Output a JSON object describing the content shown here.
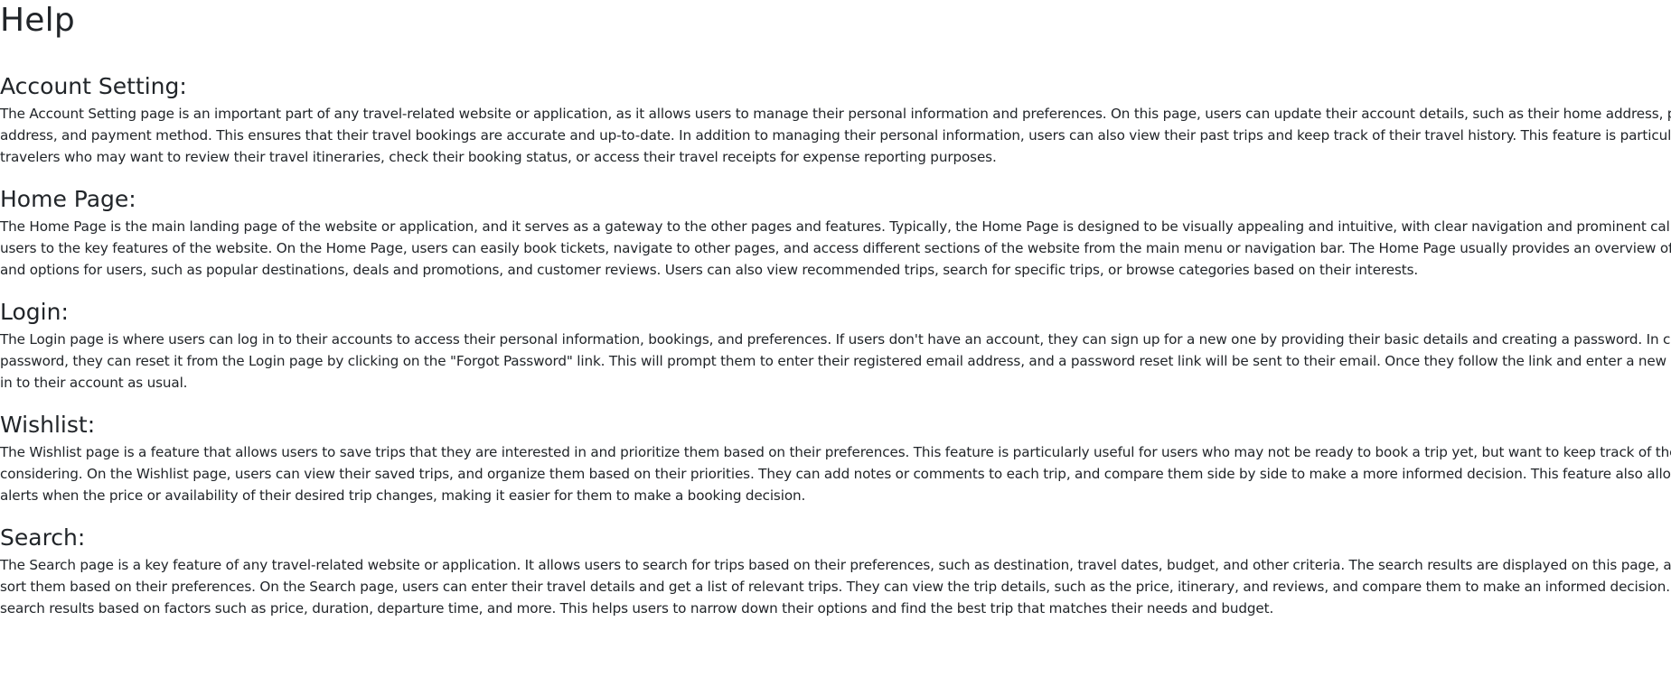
{
  "page": {
    "title": "Help"
  },
  "sections": [
    {
      "heading": "Account Setting:",
      "body": "The Account Setting page is an important part of any travel-related website or application, as it allows users to manage their personal information and preferences. On this page, users can update their account details, such as their home address, phone number, email address, and payment method. This ensures that their travel bookings are accurate and up-to-date. In addition to managing their personal information, users can also view their past trips and keep track of their travel history. This feature is particularly useful for frequent travelers who may want to review their travel itineraries, check their booking status, or access their travel receipts for expense reporting purposes."
    },
    {
      "heading": "Home Page:",
      "body": "The Home Page is the main landing page of the website or application, and it serves as a gateway to the other pages and features. Typically, the Home Page is designed to be visually appealing and intuitive, with clear navigation and prominent call-to-actions to guide users to the key features of the website. On the Home Page, users can easily book tickets, navigate to other pages, and access different sections of the website from the main menu or navigation bar. The Home Page usually provides an overview of the available features and options for users, such as popular destinations, deals and promotions, and customer reviews. Users can also view recommended trips, search for specific trips, or browse categories based on their interests."
    },
    {
      "heading": "Login:",
      "body": "The Login page is where users can log in to their accounts to access their personal information, bookings, and preferences. If users don't have an account, they can sign up for a new one by providing their basic details and creating a password. In case users forget their password, they can reset it from the Login page by clicking on the \"Forgot Password\" link. This will prompt them to enter their registered email address, and a password reset link will be sent to their email. Once they follow the link and enter a new password, they can log in to their account as usual."
    },
    {
      "heading": "Wishlist:",
      "body": "The Wishlist page is a feature that allows users to save trips that they are interested in and prioritize them based on their preferences. This feature is particularly useful for users who may not be ready to book a trip yet, but want to keep track of the trips they are considering. On the Wishlist page, users can view their saved trips, and organize them based on their priorities. They can add notes or comments to each trip, and compare them side by side to make a more informed decision. This feature also allows users to receive alerts when the price or availability of their desired trip changes, making it easier for them to make a booking decision."
    },
    {
      "heading": "Search:",
      "body": "The Search page is a key feature of any travel-related website or application. It allows users to search for trips based on their preferences, such as destination, travel dates, budget, and other criteria. The search results are displayed on this page, and users can filter and sort them based on their preferences. On the Search page, users can enter their travel details and get a list of relevant trips. They can view the trip details, such as the price, itinerary, and reviews, and compare them to make an informed decision. Users can also filter the search results based on factors such as price, duration, departure time, and more. This helps users to narrow down their options and find the best trip that matches their needs and budget."
    }
  ]
}
